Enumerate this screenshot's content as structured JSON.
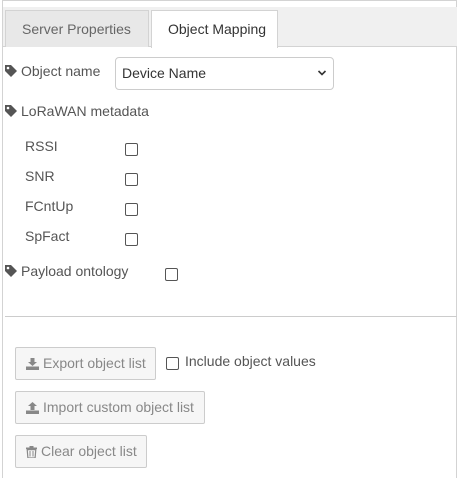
{
  "tabs": {
    "server_properties": "Server Properties",
    "object_mapping": "Object Mapping"
  },
  "object_name": {
    "label": "Object name",
    "selected": "Device Name"
  },
  "lorawan_metadata": {
    "label": "LoRaWAN metadata",
    "items": [
      {
        "label": "RSSI",
        "checked": false
      },
      {
        "label": "SNR",
        "checked": false
      },
      {
        "label": "FCntUp",
        "checked": false
      },
      {
        "label": "SpFact",
        "checked": false
      }
    ]
  },
  "payload_ontology": {
    "label": "Payload ontology",
    "checked": false
  },
  "export": {
    "button_label": "Export object list",
    "include_values_label": "Include object values",
    "include_values_checked": false
  },
  "import": {
    "button_label": "Import custom object list"
  },
  "clear": {
    "button_label": "Clear object list"
  },
  "colors": {
    "text": "#555555",
    "tab_bar_bg": "#f0f0f0",
    "border": "#d3d3d3",
    "button_bg": "#f6f6f6",
    "button_text": "#888888"
  },
  "icons": {
    "field_label": "tag-icon",
    "select_arrow": "chevron-down-icon",
    "export": "download-icon",
    "import": "upload-icon",
    "clear": "trash-icon"
  }
}
